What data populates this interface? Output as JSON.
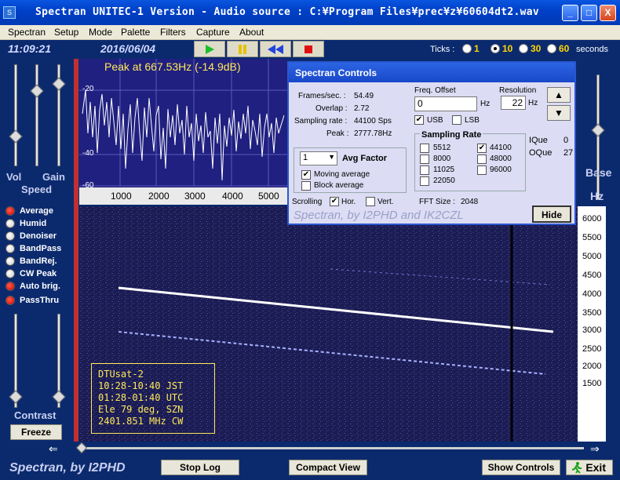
{
  "window": {
    "title": "Spectran UNITEC-1 Version  - Audio source  : C:¥Program Files¥prec¥z¥60604dt2.wav",
    "min_label": "_",
    "max_label": "□",
    "close_label": "X"
  },
  "menu": [
    "Spectran",
    "Setup",
    "Mode",
    "Palette",
    "Filters",
    "Capture",
    "About"
  ],
  "toolbar": {
    "time": "11:09:21",
    "date": "2016/06/04"
  },
  "ticks": {
    "label": "Ticks :",
    "options": [
      "1",
      "10",
      "30",
      "60"
    ],
    "selected": "10",
    "unit": "seconds"
  },
  "left": {
    "vol": "Vol",
    "gain": "Gain",
    "speed": "Speed",
    "contrast": "Contrast",
    "freeze": "Freeze",
    "toggles": [
      {
        "label": "Average",
        "on": true
      },
      {
        "label": "Humid",
        "on": false
      },
      {
        "label": "Denoiser",
        "on": false
      },
      {
        "label": "BandPass",
        "on": false
      },
      {
        "label": "BandRej.",
        "on": false
      },
      {
        "label": "CW Peak",
        "on": false
      },
      {
        "label": "Auto brig.",
        "on": true
      },
      {
        "label": "PassThru",
        "on": true
      }
    ]
  },
  "right": {
    "base": "Base",
    "hz": "Hz"
  },
  "spectrum": {
    "peak_text": "Peak at   667.53Hz (-14.9dB)",
    "y_ticks": [
      "-20",
      "-40",
      "-60"
    ],
    "x_ticks": [
      "1000",
      "2000",
      "3000",
      "4000",
      "5000"
    ]
  },
  "freq_scale": [
    "6000",
    "5500",
    "5000",
    "4500",
    "4000",
    "3500",
    "3000",
    "2500",
    "2000",
    "1500"
  ],
  "dialog": {
    "title": "Spectran Controls",
    "frames_label": "Frames/sec. :",
    "frames_value": "54.49",
    "overlap_label": "Overlap :",
    "overlap_value": "2.72",
    "sampling_label": "Sampling rate :",
    "sampling_value": "44100 Sps",
    "peak_label": "Peak :",
    "peak_value": "2777.78Hz",
    "freq_offset_label": "Freq. Offset",
    "freq_offset_value": "0",
    "hz": "Hz",
    "resolution_label": "Resolution",
    "resolution_value": "22",
    "usb": "USB",
    "lsb": "LSB",
    "sampling_rate_title": "Sampling Rate",
    "rates": [
      "5512",
      "44100",
      "8000",
      "48000",
      "11025",
      "96000",
      "22050"
    ],
    "selected_rate": "44100",
    "ique_label": "IQue",
    "ique_value": "0",
    "oque_label": "OQue",
    "oque_value": "27",
    "avg_value": "1",
    "avg_factor": "Avg Factor",
    "moving_average": "Moving average",
    "block_average": "Block average",
    "scrolling": "Scrolling",
    "hor": "Hor.",
    "vert": "Vert.",
    "fft_label": "FFT Size :",
    "fft_value": "2048",
    "watermark": "Spectran, by I2PHD and IK2CZL",
    "hide": "Hide"
  },
  "waterfall_text": [
    "DTUsat-2",
    "10:28-10:40 JST",
    "01:28-01:40 UTC",
    "Ele 79 deg, SZN",
    "2401.851 MHz CW"
  ],
  "bottom": {
    "brand": "Spectran, by I2PHD",
    "stop_log": "Stop Log",
    "compact_view": "Compact View",
    "show_controls": "Show Controls",
    "exit": "Exit"
  }
}
